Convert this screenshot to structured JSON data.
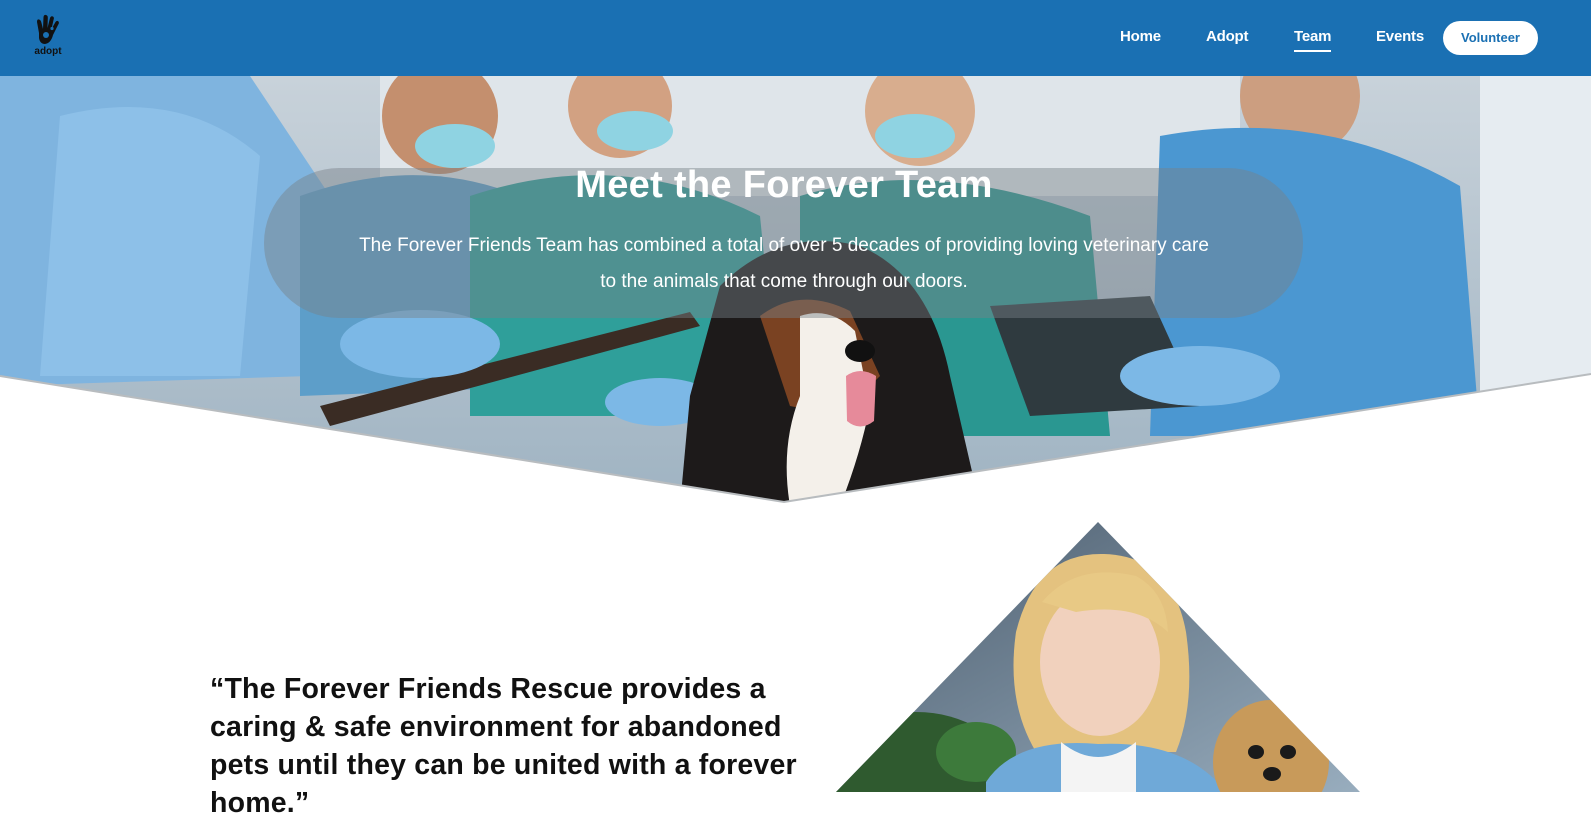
{
  "logo": {
    "text": "adopt",
    "icon": "hand-print-icon"
  },
  "nav": {
    "home": "Home",
    "adopt": "Adopt",
    "team": "Team",
    "events": "Events",
    "volunteer": "Volunteer",
    "active": "Team"
  },
  "hero": {
    "title": "Meet the Forever Team",
    "subtitle": "The Forever Friends Team has combined a total of over 5 decades of providing loving veterinary care to the animals that come through our doors."
  },
  "quote": {
    "text": "“The Forever Friends Rescue provides a caring & safe environment for abandoned pets until they can be united with a forever home.”"
  },
  "colors": {
    "brand_blue": "#1a70b3",
    "white": "#ffffff",
    "text_dark": "#111111"
  }
}
